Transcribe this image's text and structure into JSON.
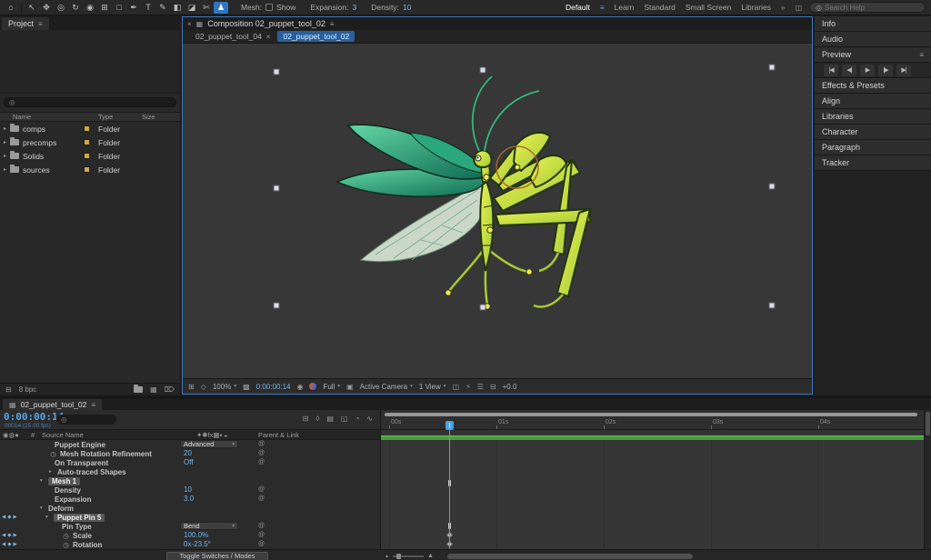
{
  "colors": {
    "accent_blue": "#2f76c0",
    "value_blue": "#74b3e8",
    "timecode_blue": "#55a3e4",
    "cache_green": "#4a9d3f",
    "folder_swatch": "#d2ab3a",
    "active_panel_border": "#3c7ac2",
    "selected_tab_blue": "#2a5f9e"
  },
  "icons": {
    "menu": "≡",
    "close": "×",
    "chevron": "▾",
    "search": "◎",
    "twirl_open": "▾",
    "twirl_closed": "▸",
    "stopwatch": "◷",
    "pickwhip": "@",
    "key_prev": "◀",
    "keyframe": "◆",
    "key_next": "▶",
    "comp": "▦",
    "grid": "⊞",
    "mask": "◇",
    "camera": "◉",
    "snapshot": "◨",
    "roi": "▣",
    "transparency": "▩",
    "pixel_aspect": "◫",
    "fast_preview": "⚡",
    "timeline_button": "☰",
    "flowchart": "⊟",
    "trash": "⌦",
    "overflow": "»"
  },
  "toolbar": {
    "tools": [
      {
        "name": "home",
        "glyph": "⌂"
      },
      {
        "name": "selection-tool",
        "glyph": "↖"
      },
      {
        "name": "hand-tool",
        "glyph": "✥"
      },
      {
        "name": "zoom-tool",
        "glyph": "◎"
      },
      {
        "name": "orbit-camera-tool",
        "glyph": "↻"
      },
      {
        "name": "camera-tool",
        "glyph": "◉"
      },
      {
        "name": "pan-behind-tool",
        "glyph": "⊞"
      },
      {
        "name": "shape-tool",
        "glyph": "□"
      },
      {
        "name": "pen-tool",
        "glyph": "✒"
      },
      {
        "name": "type-tool",
        "glyph": "T"
      },
      {
        "name": "brush-tool",
        "glyph": "✎"
      },
      {
        "name": "clone-stamp-tool",
        "glyph": "◧"
      },
      {
        "name": "eraser-tool",
        "glyph": "◪"
      },
      {
        "name": "roto-brush-tool",
        "glyph": "✄"
      },
      {
        "name": "puppet-pin-tool",
        "glyph": "♟"
      }
    ],
    "mesh_label": "Mesh:",
    "show_label": "Show",
    "expansion_label": "Expansion:",
    "expansion_value": "3",
    "density_label": "Density:",
    "density_value": "10",
    "workspaces": [
      "Default",
      "Learn",
      "Standard",
      "Small Screen",
      "Libraries"
    ],
    "active_workspace": "Default",
    "search_placeholder": "Search Help"
  },
  "project": {
    "tab_label": "Project",
    "columns": {
      "name": "Name",
      "type": "Type",
      "size": "Size"
    },
    "rows": [
      {
        "name": "comps",
        "type": "Folder"
      },
      {
        "name": "precomps",
        "type": "Folder"
      },
      {
        "name": "Solids",
        "type": "Folder"
      },
      {
        "name": "sources",
        "type": "Folder"
      }
    ],
    "footer_bpc": "8 bpc"
  },
  "composition": {
    "panel_tab": "Composition 02_puppet_tool_02",
    "viewer_tabs": [
      {
        "label": "02_puppet_tool_04",
        "active": false
      },
      {
        "label": "02_puppet_tool_02",
        "active": true
      }
    ],
    "statusbar": {
      "zoom": "100%",
      "timecode": "0:00:00:14",
      "resolution": "Full",
      "camera_view": "Active Camera",
      "view_layout": "1 View",
      "exposure": "+0.0"
    }
  },
  "right_panel": {
    "panels": [
      "Info",
      "Audio",
      "Preview",
      "Effects & Presets",
      "Align",
      "Libraries",
      "Character",
      "Paragraph",
      "Tracker"
    ],
    "transport": [
      {
        "name": "first-frame",
        "glyph": "|◀"
      },
      {
        "name": "previous-frame",
        "glyph": "◀|"
      },
      {
        "name": "play",
        "glyph": "▶"
      },
      {
        "name": "next-frame",
        "glyph": "|▶"
      },
      {
        "name": "last-frame",
        "glyph": "▶|"
      }
    ]
  },
  "timeline": {
    "tab_label": "02_puppet_tool_02",
    "current_timecode": "0:00:00:14",
    "frame_info": "00014 (25.00 fps)",
    "av_header_icons": "◉◍●",
    "hash_header": "#",
    "column_source_name": "Source Name",
    "switch_header_icons": "✦✱fx▦◐◒",
    "column_parent": "Parent & Link",
    "header_icons": [
      {
        "name": "comp-mini-flowchart",
        "glyph": "⊟"
      },
      {
        "name": "draft-3d",
        "glyph": "◊"
      },
      {
        "name": "hide-shy-layers",
        "glyph": "▤"
      },
      {
        "name": "frame-blending",
        "glyph": "◱"
      },
      {
        "name": "motion-blur",
        "glyph": "◔"
      },
      {
        "name": "graph-editor",
        "glyph": "∿"
      }
    ],
    "rows": [
      {
        "label": "Puppet Engine",
        "value": "Advanced",
        "control": "dropdown"
      },
      {
        "label": "Mesh Rotation Refinement",
        "value": "20"
      },
      {
        "label": "On Transparent",
        "value": "Off"
      },
      {
        "label": "Auto-traced Shapes"
      },
      {
        "label": "Mesh 1",
        "selected": true
      },
      {
        "label": "Density",
        "value": "10"
      },
      {
        "label": "Expansion",
        "value": "3.0"
      },
      {
        "label": "Deform"
      },
      {
        "label": "Puppet Pin 5",
        "selected": true
      },
      {
        "label": "Pin Type",
        "value": "Bend",
        "control": "dropdown"
      },
      {
        "label": "Scale",
        "value": "100.0%"
      },
      {
        "label": "Rotation",
        "value": "0x-23.5°"
      }
    ],
    "ruler_labels": [
      "00s",
      "01s",
      "02s",
      "03s",
      "04s"
    ],
    "toggle_button": "Toggle Switches / Modes"
  }
}
